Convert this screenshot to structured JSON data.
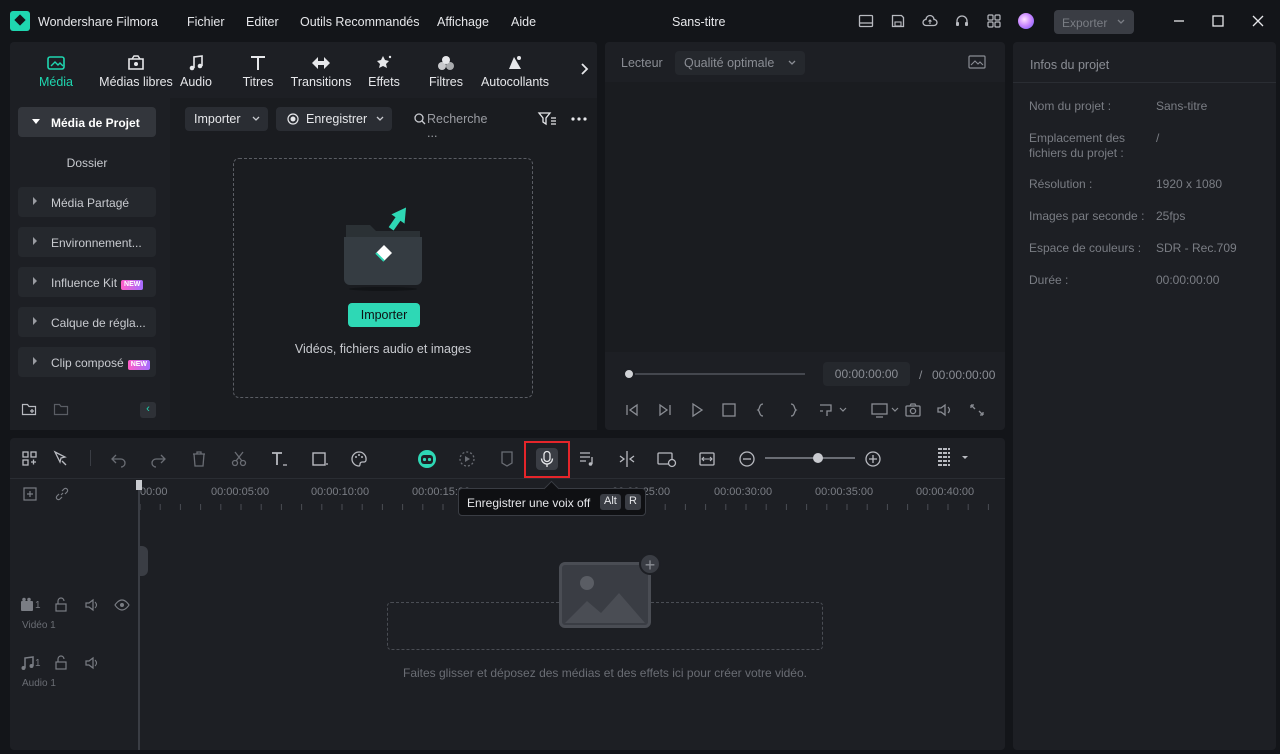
{
  "app": {
    "name": "Wondershare Filmora",
    "doc_title": "Sans-titre",
    "accent": "#1fd6b0"
  },
  "menu": [
    "Fichier",
    "Editer",
    "Outils Recommandés",
    "Affichage",
    "Aide"
  ],
  "titlebar": {
    "export_label": "Exporter",
    "icons": [
      "layout-icon",
      "save-icon",
      "cloud-icon",
      "headset-icon",
      "grid-icon",
      "avatar"
    ]
  },
  "media_tabs": [
    {
      "label": "Média",
      "icon": "media-icon",
      "active": true
    },
    {
      "label": "Médias libres",
      "icon": "stock-media-icon"
    },
    {
      "label": "Audio",
      "icon": "music-icon"
    },
    {
      "label": "Titres",
      "icon": "title-icon"
    },
    {
      "label": "Transitions",
      "icon": "transition-icon"
    },
    {
      "label": "Effets",
      "icon": "effects-icon"
    },
    {
      "label": "Filtres",
      "icon": "filters-icon"
    },
    {
      "label": "Autocollants",
      "icon": "sticker-icon"
    }
  ],
  "sidebar": {
    "project_media": "Média de Projet",
    "folder": "Dossier",
    "items": [
      {
        "label": "Média Partagé"
      },
      {
        "label": "Environnement..."
      },
      {
        "label": "Influence Kit",
        "badge": "NEW"
      },
      {
        "label": "Calque de régla..."
      },
      {
        "label": "Clip composé",
        "badge": "NEW"
      }
    ]
  },
  "media_toolbar": {
    "import": "Importer",
    "record": "Enregistrer",
    "search_placeholder": "Recherche ..."
  },
  "dropzone": {
    "button": "Importer",
    "text": "Vidéos, fichiers audio et images"
  },
  "player": {
    "label": "Lecteur",
    "quality": "Qualité optimale",
    "current_time": "00:00:00:00",
    "separator": "/",
    "total_time": "00:00:00:00"
  },
  "project_info": {
    "title": "Infos du projet",
    "rows": [
      {
        "key": "Nom du projet :",
        "value": "Sans-titre"
      },
      {
        "key": "Emplacement des fichiers du projet :",
        "value": "/"
      },
      {
        "key": "Résolution :",
        "value": "1920 x 1080"
      },
      {
        "key": "Images par seconde :",
        "value": "25fps"
      },
      {
        "key": "Espace de couleurs :",
        "value": "SDR - Rec.709"
      },
      {
        "key": "Durée :",
        "value": "00:00:00:00"
      }
    ]
  },
  "timeline": {
    "ruler": [
      "00:00",
      "00:00:05:00",
      "00:00:10:00",
      "00:00:15:00",
      "00:00:25:00",
      "00:00:30:00",
      "00:00:35:00",
      "00:00:40:00"
    ],
    "tooltip": {
      "text": "Enregistrer une voix off",
      "key1": "Alt",
      "key2": "R"
    },
    "tracks": [
      {
        "name": "Vidéo 1",
        "number": "1"
      },
      {
        "name": "Audio 1",
        "number": "1"
      }
    ],
    "drop_text": "Faites glisser et déposez des médias et des effets ici pour créer votre vidéo."
  }
}
